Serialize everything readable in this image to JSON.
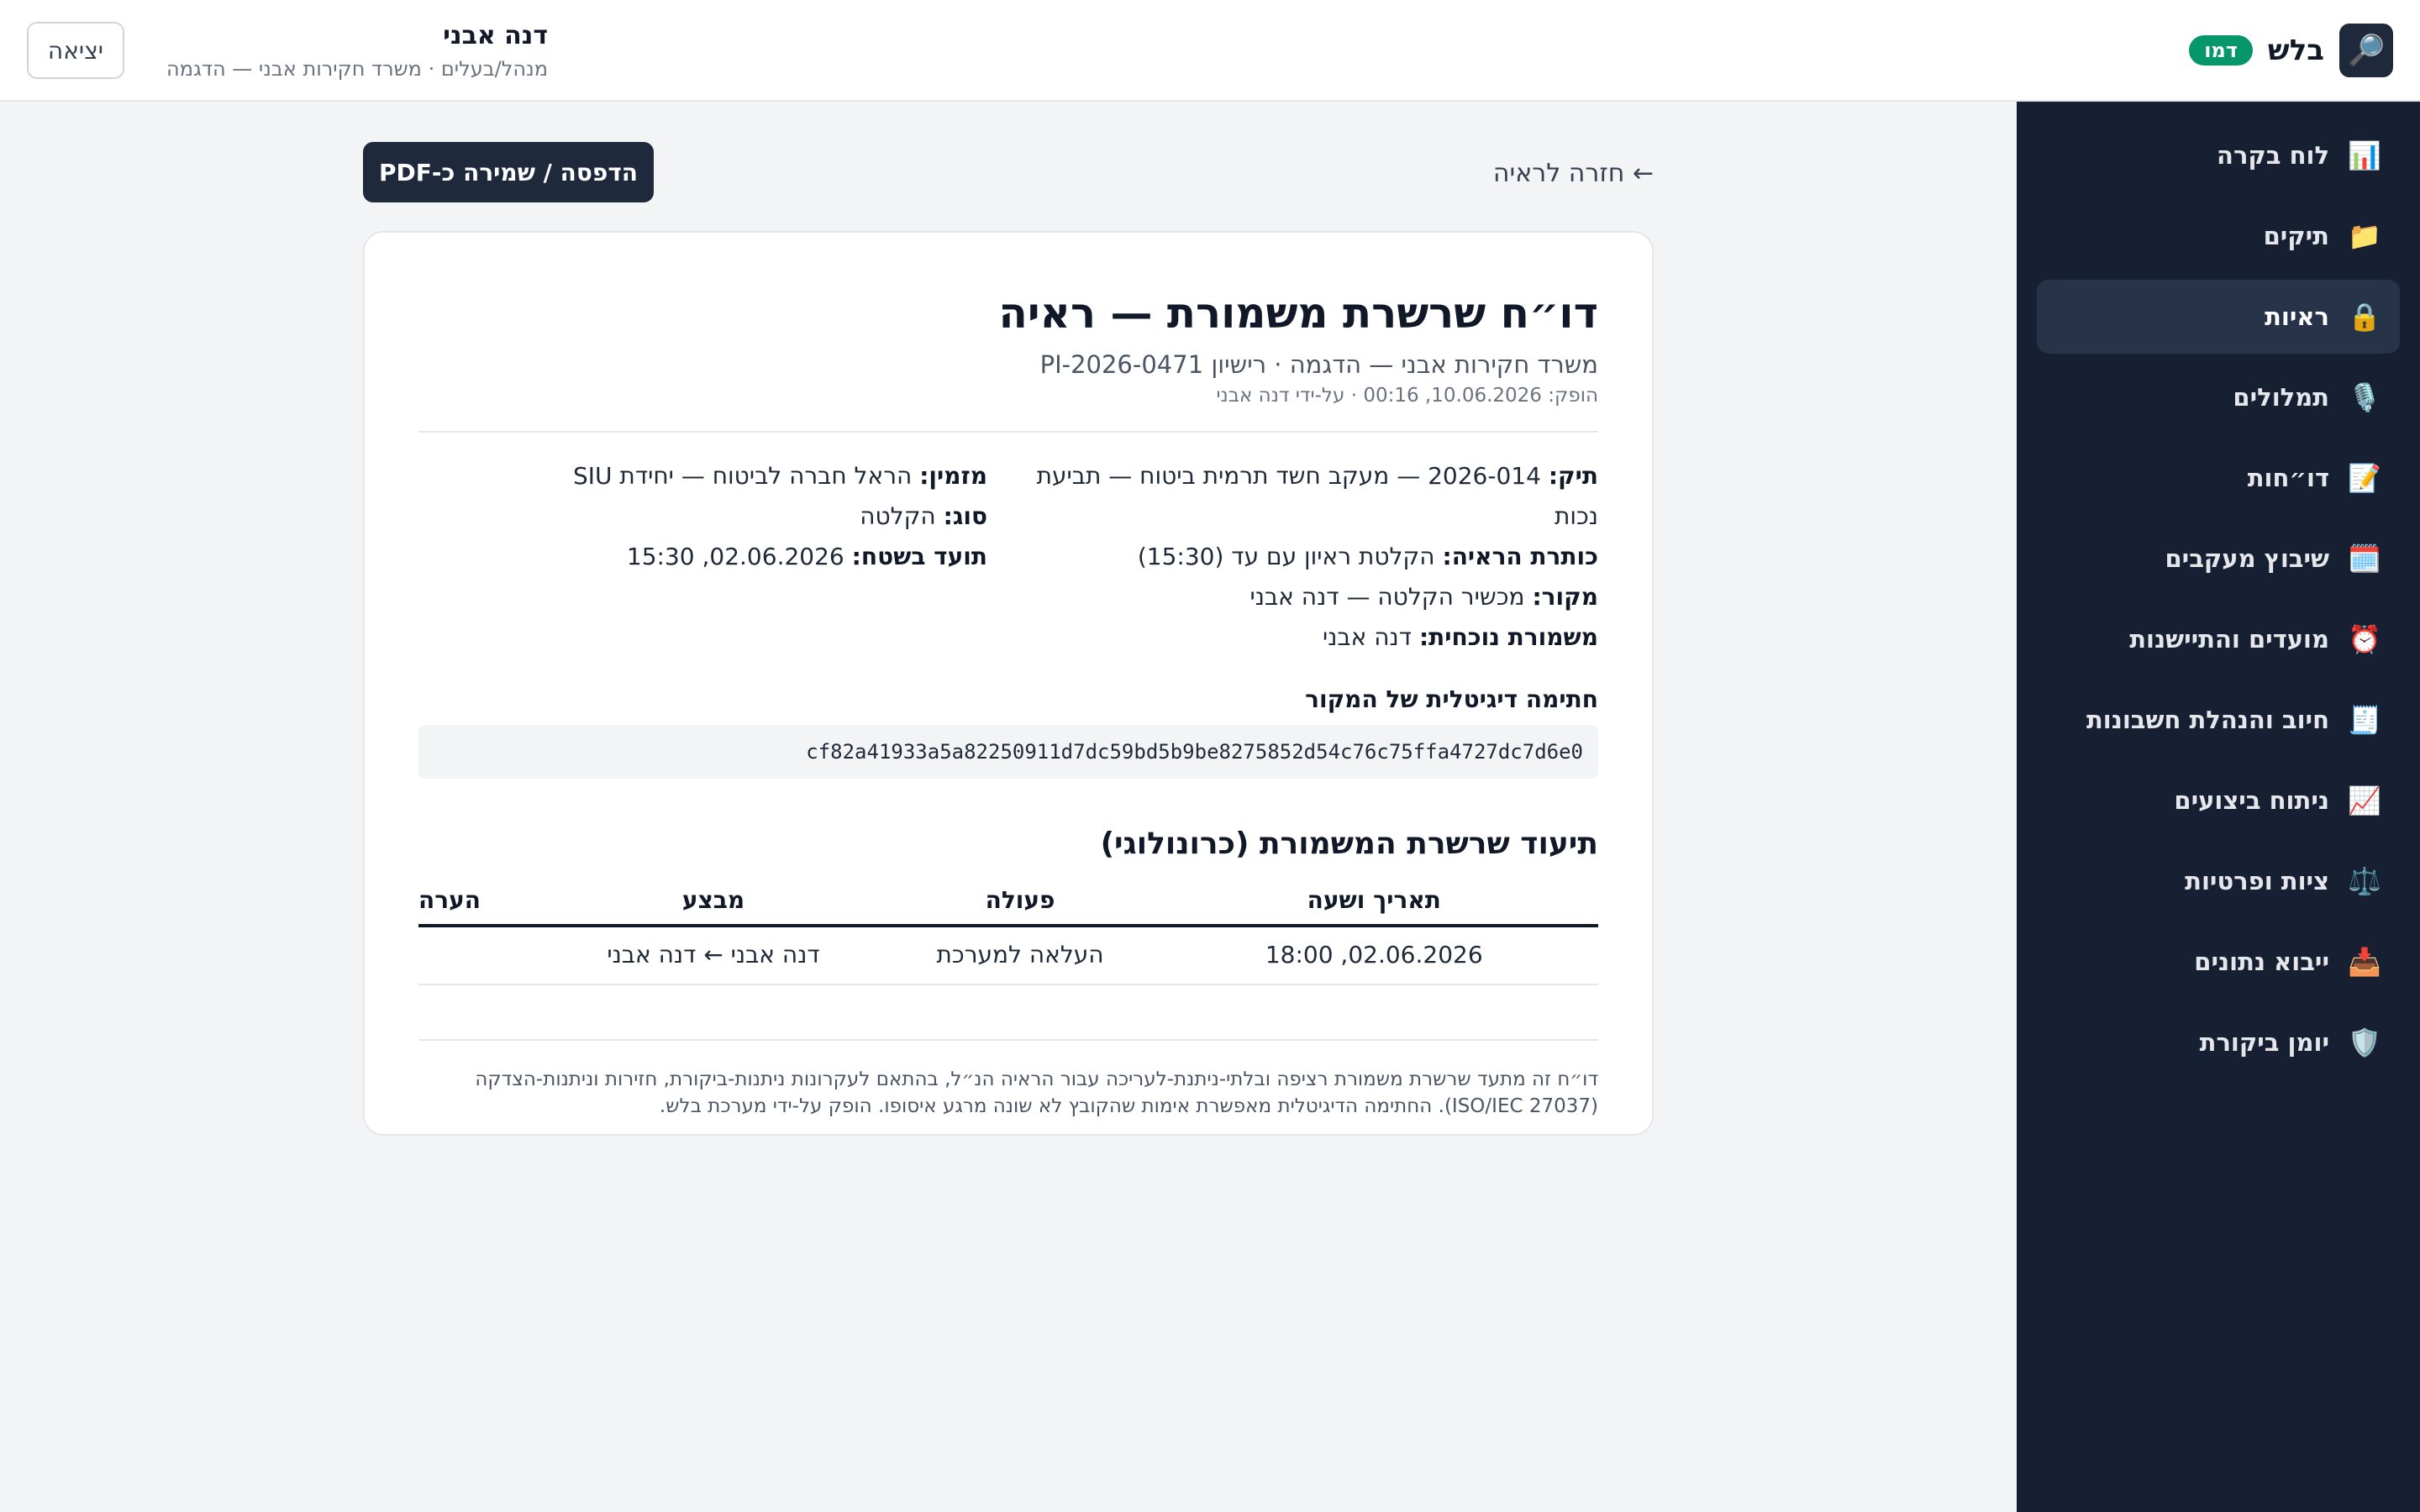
{
  "app": {
    "brand": "בלש",
    "brand_icon": "magnifier-icon",
    "demo_badge": "דמו"
  },
  "user": {
    "name": "דנה אבני",
    "role": "מנהל/בעלים · משרד חקירות אבני — הדגמה",
    "logout": "יציאה"
  },
  "sidebar": {
    "items": [
      {
        "label": "לוח בקרה",
        "icon": "📊",
        "active": false
      },
      {
        "label": "תיקים",
        "icon": "📁",
        "active": false
      },
      {
        "label": "ראיות",
        "icon": "🔒",
        "active": true
      },
      {
        "label": "תמלולים",
        "icon": "🎙️",
        "active": false
      },
      {
        "label": "דו״חות",
        "icon": "📝",
        "active": false
      },
      {
        "label": "שיבוץ מעקבים",
        "icon": "🗓️",
        "active": false
      },
      {
        "label": "מועדים והתיישנות",
        "icon": "⏰",
        "active": false
      },
      {
        "label": "חיוב והנהלת חשבונות",
        "icon": "🧾",
        "active": false
      },
      {
        "label": "ניתוח ביצועים",
        "icon": "📈",
        "active": false
      },
      {
        "label": "ציות ופרטיות",
        "icon": "⚖️",
        "active": false
      },
      {
        "label": "ייבוא נתונים",
        "icon": "📥",
        "active": false
      },
      {
        "label": "יומן ביקורת",
        "icon": "🛡️",
        "active": false
      }
    ]
  },
  "toolbar": {
    "back": "← חזרה לראיה",
    "print": "הדפסה / שמירה כ-PDF"
  },
  "report": {
    "title": "דו״ח שרשרת משמורת — ראיה",
    "subtitle": "משרד חקירות אבני — הדגמה · רישיון PI-2026-0471",
    "meta": "הופק: 10.06.2026, 00:16 · על-ידי דנה אבני",
    "fields_right": [
      {
        "label": "תיק:",
        "value": "2026-014 — מעקב חשד תרמית ביטוח — תביעת נכות"
      },
      {
        "label": "כותרת הראיה:",
        "value": "הקלטת ראיון עם עד (15:30)"
      },
      {
        "label": "מקור:",
        "value": "מכשיר הקלטה — דנה אבני"
      },
      {
        "label": "משמורת נוכחית:",
        "value": "דנה אבני"
      }
    ],
    "fields_left": [
      {
        "label": "מזמין:",
        "value": "הראל חברה לביטוח — יחידת SIU"
      },
      {
        "label": "סוג:",
        "value": "הקלטה"
      },
      {
        "label": "תועד בשטח:",
        "value": "02.06.2026, 15:30"
      }
    ],
    "signature_title": "חתימה דיגיטלית של המקור",
    "signature": "cf82a41933a5a82250911d7dc59bd5b9be8275852d54c76c75ffa4727dc7d6e0",
    "log_title": "תיעוד שרשרת המשמורת (כרונולוגי)",
    "columns": [
      "תאריך ושעה",
      "פעולה",
      "מבצע",
      "הערה"
    ],
    "rows": [
      {
        "datetime": "02.06.2026, 18:00",
        "action": "העלאה למערכת",
        "actor": "דנה אבני ← דנה אבני",
        "note": ""
      }
    ],
    "footnote": "דו״ח זה מתעד שרשרת משמורת רציפה ובלתי-ניתנת-לעריכה עבור הראיה הנ״ל, בהתאם לעקרונות ניתנות-ביקורת, חזירות וניתנות-הצדקה (ISO/IEC 27037). החתימה הדיגיטלית מאפשרת אימות שהקובץ לא שונה מרגע איסופו. הופק על-ידי מערכת בלש."
  }
}
